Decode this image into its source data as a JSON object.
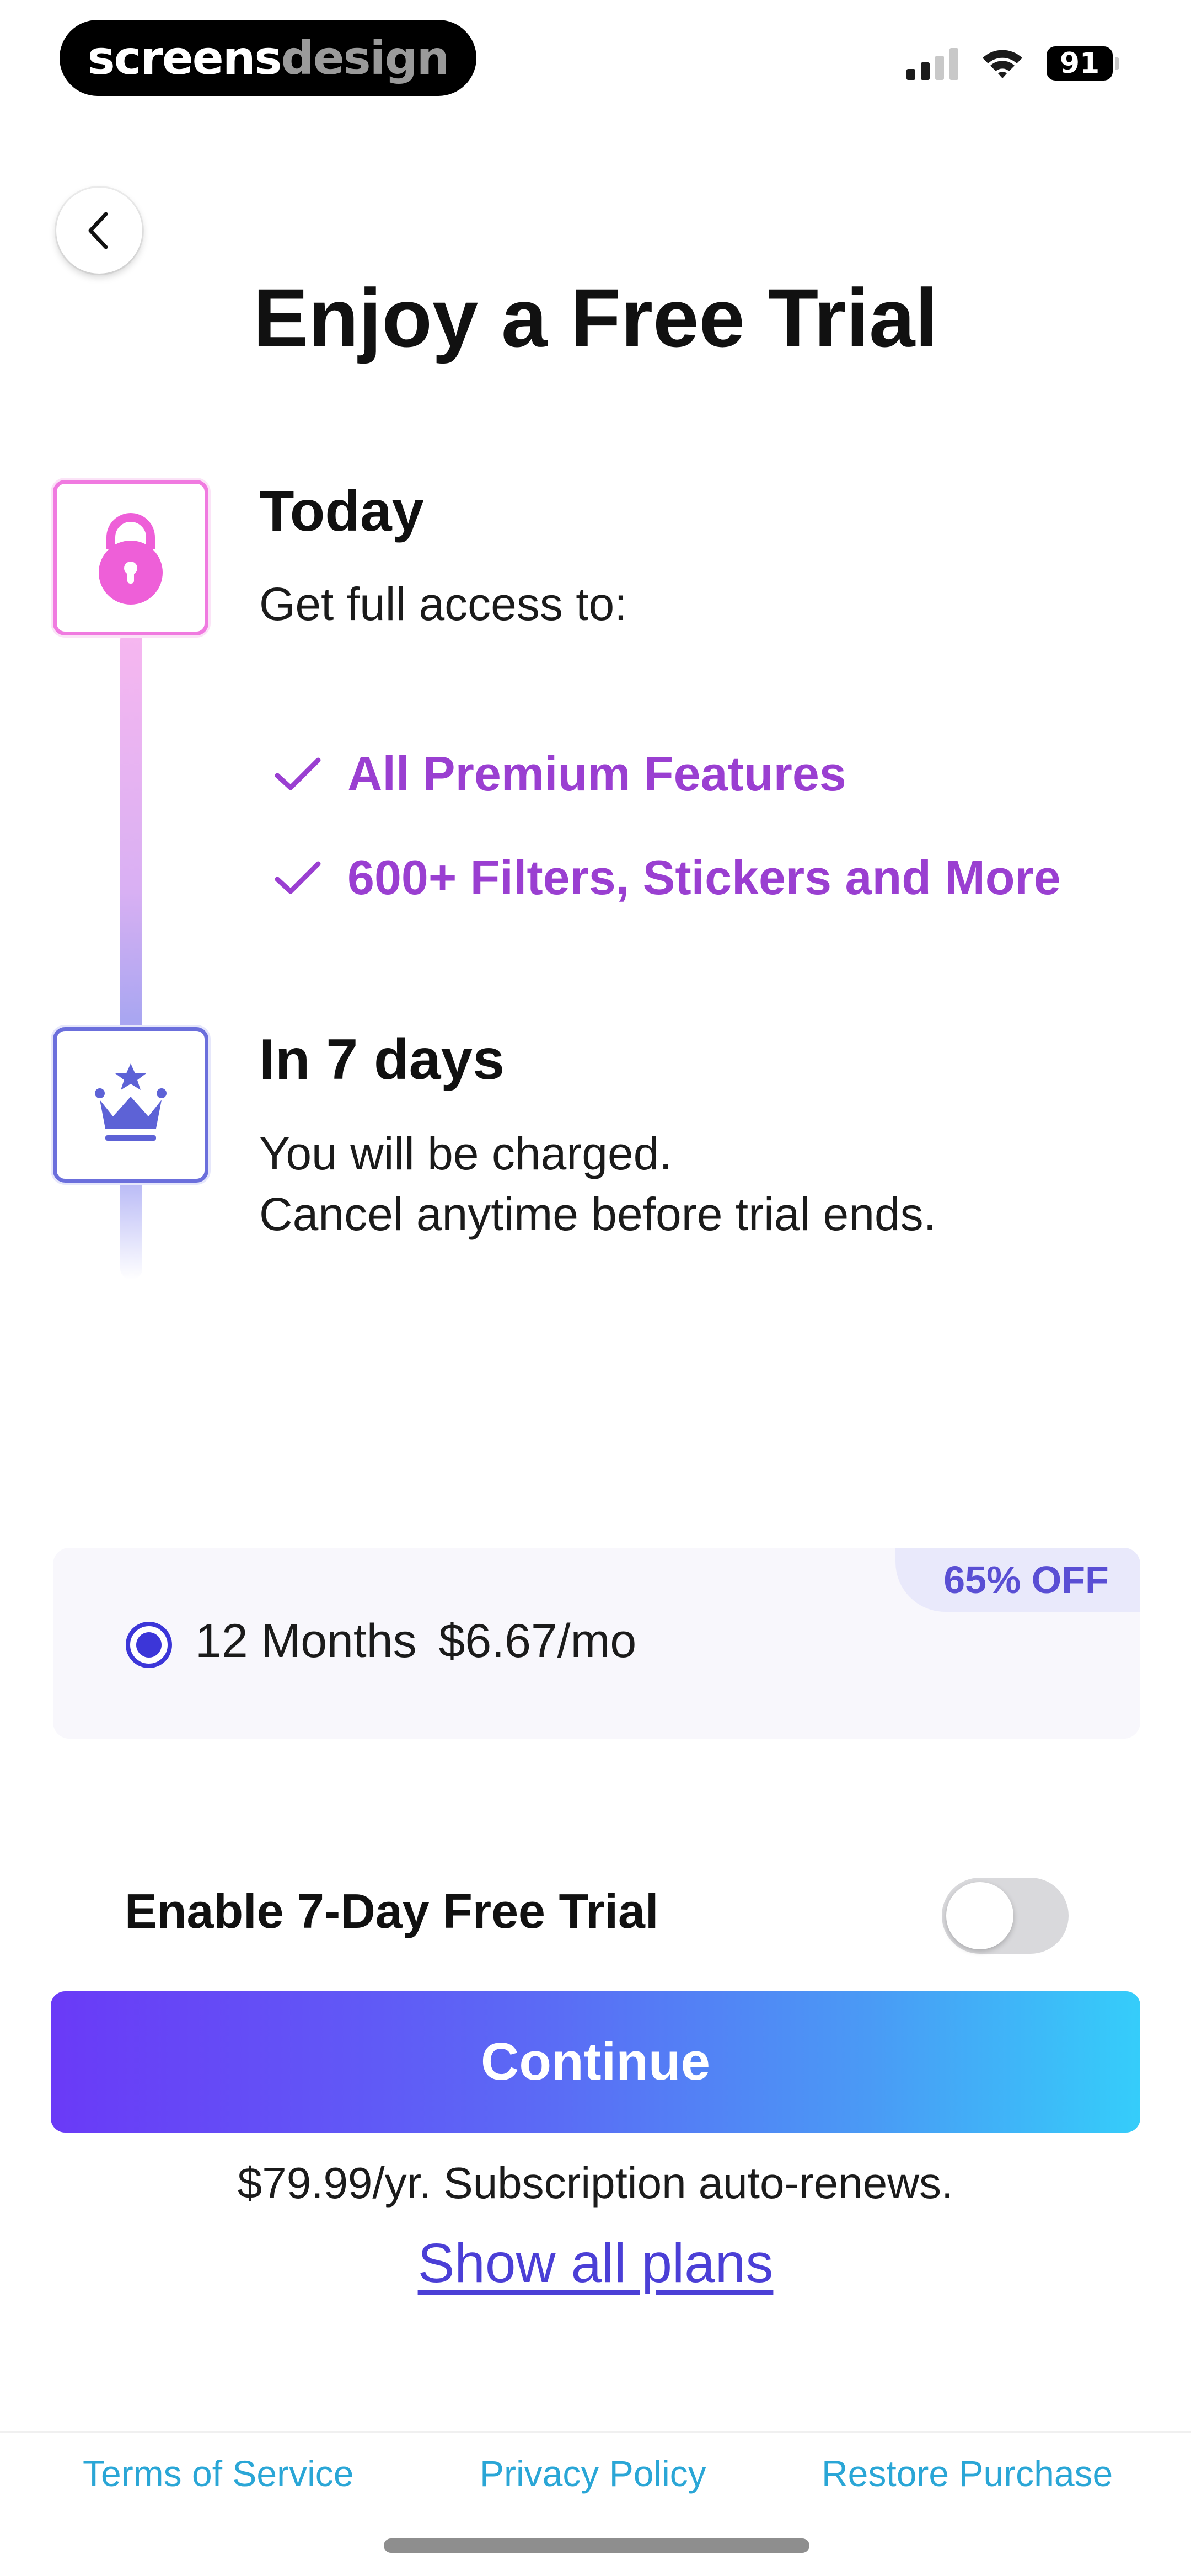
{
  "status_bar": {
    "brand_part1": "screens",
    "brand_part2": "design",
    "battery_level": "91"
  },
  "header": {
    "title": "Enjoy a Free Trial"
  },
  "timeline": {
    "step1": {
      "title": "Today",
      "subtitle": "Get full access to:",
      "features": [
        "All Premium Features",
        "600+ Filters, Stickers and More"
      ]
    },
    "step2": {
      "title": "In 7 days",
      "line1": "You will be charged.",
      "line2": "Cancel anytime before trial ends."
    }
  },
  "plan": {
    "badge": "65% OFF",
    "duration": "12 Months",
    "price": "$6.67/mo",
    "selected": true
  },
  "trial_toggle": {
    "label": "Enable 7-Day Free Trial",
    "enabled": false
  },
  "cta": {
    "continue_label": "Continue",
    "price_note": "$79.99/yr. Subscription auto-renews.",
    "show_all_plans": "Show all plans"
  },
  "footer": {
    "terms": "Terms of Service",
    "privacy": "Privacy Policy",
    "restore": "Restore Purchase"
  },
  "colors": {
    "accent_purple": "#9a3fd1",
    "radio_blue": "#3c36d8",
    "badge_text": "#5a4fd4",
    "link_blue": "#2aa6d6",
    "lock_pink": "#f07ae0",
    "crown_blue": "#6b6fdc",
    "gradient_start": "#6a3af7",
    "gradient_end": "#35cdfa"
  },
  "icons": {
    "back": "chevron-left-icon",
    "lock": "lock-icon",
    "crown": "crown-icon",
    "check": "check-icon",
    "signal": "cellular-signal-icon",
    "wifi": "wifi-icon",
    "battery": "battery-icon"
  }
}
